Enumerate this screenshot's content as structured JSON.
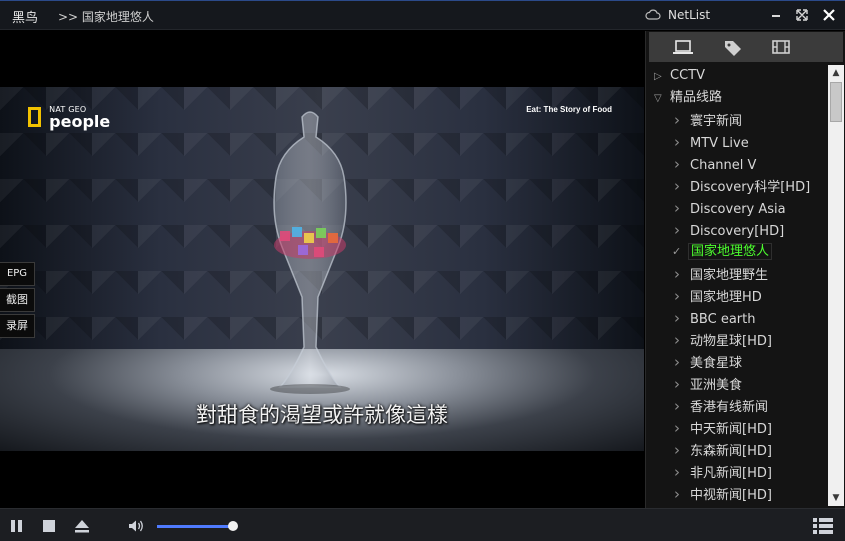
{
  "titlebar": {
    "app_title": "黑鸟",
    "now_playing": ">> 国家地理悠人",
    "panel_title": "NetList",
    "min_icon": "minimize-icon",
    "max_icon": "maximize-icon",
    "close_icon": "close-icon"
  },
  "video": {
    "brand_top": "NAT GEO",
    "brand_bottom": "people",
    "show_tag": "Eat: The Story of Food",
    "subtitle": "對甜食的渴望或許就像這樣"
  },
  "side_buttons": {
    "epg": "EPG",
    "snapshot": "截图",
    "record": "录屏"
  },
  "panel": {
    "tabs": [
      "screen-icon",
      "tags-icon",
      "film-icon"
    ],
    "tree": {
      "groups": [
        {
          "label": "CCTV",
          "expanded": false
        },
        {
          "label": "精品线路",
          "expanded": true
        }
      ],
      "channels": [
        "寰宇新闻",
        "MTV Live",
        "Channel V",
        "Discovery科学[HD]",
        "Discovery Asia",
        "Discovery[HD]",
        "国家地理悠人",
        "国家地理野生",
        "国家地理HD",
        "BBC earth",
        "动物星球[HD]",
        "美食星球",
        "亚洲美食",
        "香港有线新闻",
        "中天新闻[HD]",
        "东森新闻[HD]",
        "非凡新闻[HD]",
        "中视新闻[HD]"
      ],
      "active_channel": "国家地理悠人"
    }
  },
  "controls": {
    "volume_fraction": 0.97,
    "icons": [
      "pause-icon",
      "stop-icon",
      "eject-icon",
      "volume-icon",
      "playlist-icon"
    ]
  },
  "colors": {
    "active_channel": "#4cff2e",
    "volume_fill": "#4f7bff",
    "brand_yellow": "#f2c200"
  }
}
